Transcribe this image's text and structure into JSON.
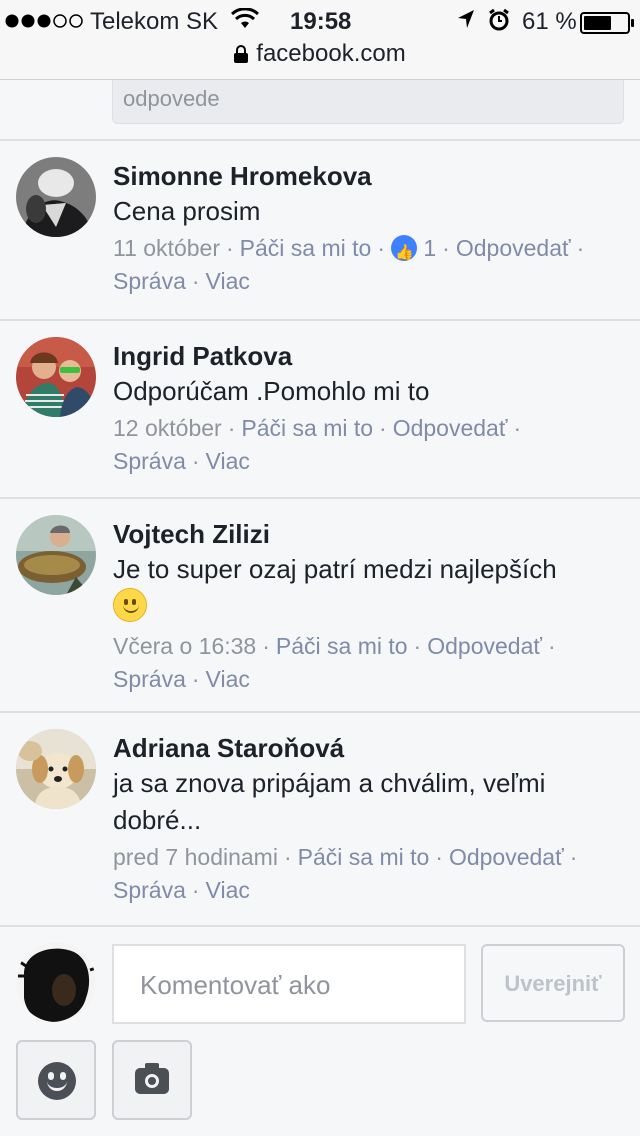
{
  "status_bar": {
    "carrier": "Telekom SK",
    "time": "19:58",
    "battery": "61 %",
    "battery_level": 0.61,
    "url": "facebook.com"
  },
  "reply_fragment": {
    "placeholder": "odpovede"
  },
  "comments": [
    {
      "name": "Simonne Hromekova",
      "text": "Cena prosim",
      "time": "11 október",
      "like_label": "Páči sa mi to",
      "like_count": "1",
      "reply_label": "Odpovedať",
      "message_label": "Správa",
      "more_label": "Viac"
    },
    {
      "name": "Ingrid Patkova",
      "text": "Odporúčam .Pomohlo mi to",
      "time": "12 október",
      "like_label": "Páči sa mi to",
      "reply_label": "Odpovedať",
      "message_label": "Správa",
      "more_label": "Viac"
    },
    {
      "name": "Vojtech Zilizi",
      "text": "Je to super ozaj patrí medzi najlepších",
      "time": "Včera o 16:38",
      "like_label": "Páči sa mi to",
      "reply_label": "Odpovedať",
      "message_label": "Správa",
      "more_label": "Viac"
    },
    {
      "name": "Adriana Staroňová",
      "text": "ja sa znova pripájam a chválim, veľmi dobré...",
      "time": "pred 7 hodinami",
      "like_label": "Páči sa mi to",
      "reply_label": "Odpovedať",
      "message_label": "Správa",
      "more_label": "Viac"
    }
  ],
  "composer": {
    "placeholder": "Komentovať ako",
    "publish_label": "Uverejniť"
  },
  "colors": {
    "link": "#7f8ba8",
    "like_blue": "#4080ff",
    "background": "#f6f7f9"
  }
}
